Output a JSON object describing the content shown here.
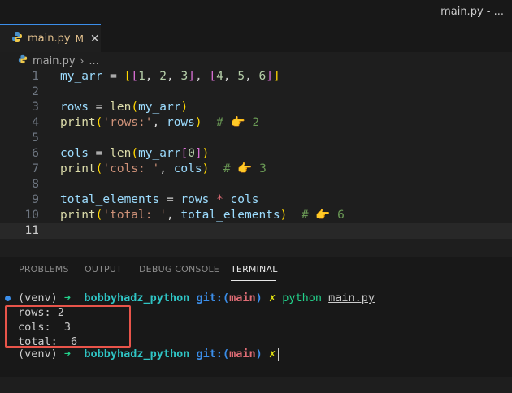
{
  "window": {
    "title": "main.py - ..."
  },
  "tab": {
    "label": "main.py",
    "modified": "M",
    "close": "✕"
  },
  "breadcrumb": {
    "file": "main.py",
    "sep": "›",
    "rest": "..."
  },
  "editor": {
    "lines": [
      {
        "n": "1"
      },
      {
        "n": "2"
      },
      {
        "n": "3"
      },
      {
        "n": "4"
      },
      {
        "n": "5"
      },
      {
        "n": "6"
      },
      {
        "n": "7"
      },
      {
        "n": "8"
      },
      {
        "n": "9"
      },
      {
        "n": "10"
      },
      {
        "n": "11"
      }
    ],
    "emoji": "👉",
    "comment_values": [
      "2",
      "3",
      "6"
    ]
  },
  "panel": {
    "tabs": [
      "PROBLEMS",
      "OUTPUT",
      "DEBUG CONSOLE",
      "TERMINAL"
    ],
    "active_tab": "TERMINAL"
  },
  "terminal": {
    "venv": "(venv)",
    "arrow": "➜",
    "dir": "bobbyhadz_python",
    "git_label": "git:(",
    "branch": "main",
    "git_close": ")",
    "x": "✗",
    "command": "python",
    "arg": "main.py",
    "output": [
      "rows: 2",
      "cols:  3",
      "total:  6"
    ]
  },
  "colors": {
    "accent": "#3b8eea",
    "highlight_box": "#e8544a"
  }
}
